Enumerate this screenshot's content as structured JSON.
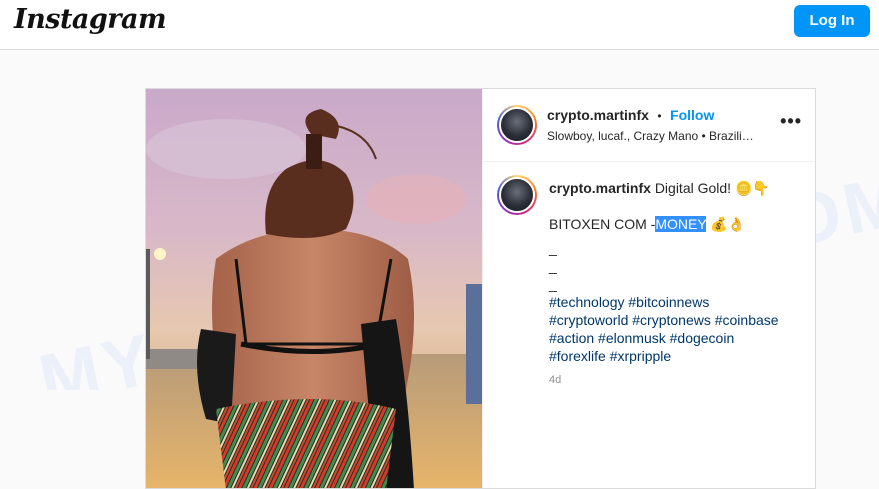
{
  "header": {
    "logo_text": "Instagram",
    "login_label": "Log In"
  },
  "watermark": {
    "text": "MYANTISPYWARE.COM"
  },
  "post": {
    "username": "crypto.martinfx",
    "separator": "•",
    "follow_label": "Follow",
    "subtitle": "Slowboy, lucaf., Crazy Mano • Brazili…",
    "more_icon": "more-horizontal-icon",
    "caption": {
      "username": "crypto.martinfx",
      "text": "Digital Gold!",
      "emoji1": "🪙👇",
      "line2_prefix": "BITOXEN COM -",
      "line2_highlight": "MONEY",
      "line2_emoji": "💰👌",
      "dash1": "_",
      "dash2": "_",
      "dash3": "_",
      "hashtags_line1": "#technology #bitcoinnews",
      "hashtags_line2": "#cryptoworld #cryptonews #coinbase",
      "hashtags_line3": "#action #elonmusk #dogecoin",
      "hashtags_line4": "#forexlife #xrpripple"
    },
    "time_ago": "4d"
  },
  "colors": {
    "accent": "#0095f6",
    "hashtag": "#00376b",
    "highlight": "#3390ff"
  }
}
